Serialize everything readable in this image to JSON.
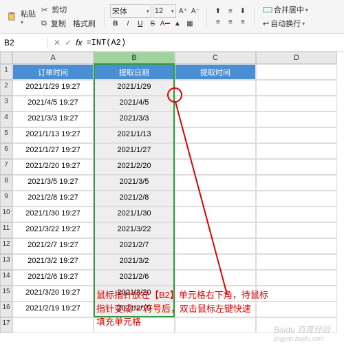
{
  "toolbar": {
    "paste": "粘贴",
    "cut": "剪切",
    "copy": "复制",
    "format_painter": "格式刷",
    "font_name": "宋体",
    "font_size": "12",
    "merge": "合并居中",
    "wrap": "自动换行"
  },
  "formula_bar": {
    "name_box": "B2",
    "fx": "fx",
    "formula": "=INT(A2)"
  },
  "columns": [
    "A",
    "B",
    "C",
    "D"
  ],
  "headers": {
    "a": "订单时间",
    "b": "提取日期",
    "c": "提取时间"
  },
  "rows": [
    {
      "r": "2",
      "a": "2021/1/29 19:27",
      "b": "2021/1/29"
    },
    {
      "r": "3",
      "a": "2021/4/5 19:27",
      "b": "2021/4/5"
    },
    {
      "r": "4",
      "a": "2021/3/3 19:27",
      "b": "2021/3/3"
    },
    {
      "r": "5",
      "a": "2021/1/13 19:27",
      "b": "2021/1/13"
    },
    {
      "r": "6",
      "a": "2021/1/27 19:27",
      "b": "2021/1/27"
    },
    {
      "r": "7",
      "a": "2021/2/20 19:27",
      "b": "2021/2/20"
    },
    {
      "r": "8",
      "a": "2021/3/5 19:27",
      "b": "2021/3/5"
    },
    {
      "r": "9",
      "a": "2021/2/8 19:27",
      "b": "2021/2/8"
    },
    {
      "r": "10",
      "a": "2021/1/30 19:27",
      "b": "2021/1/30"
    },
    {
      "r": "11",
      "a": "2021/3/22 19:27",
      "b": "2021/3/22"
    },
    {
      "r": "12",
      "a": "2021/2/7 19:27",
      "b": "2021/2/7"
    },
    {
      "r": "13",
      "a": "2021/3/2 19:27",
      "b": "2021/3/2"
    },
    {
      "r": "14",
      "a": "2021/2/6 19:27",
      "b": "2021/2/6"
    },
    {
      "r": "15",
      "a": "2021/3/20 19:27",
      "b": "2021/3/20"
    },
    {
      "r": "16",
      "a": "2021/2/19 19:27",
      "b": "2021/2/19"
    }
  ],
  "row17": "17",
  "annotation": {
    "line1": "鼠标指针放在【B2】单元格右下角，待鼠标",
    "line2": "指针变成\"+\"符号后，双击鼠标左键快速",
    "line3": "填充单元格"
  },
  "watermark": {
    "main": "Baidu 百度经验",
    "sub": "jingyan.baidu.com"
  }
}
